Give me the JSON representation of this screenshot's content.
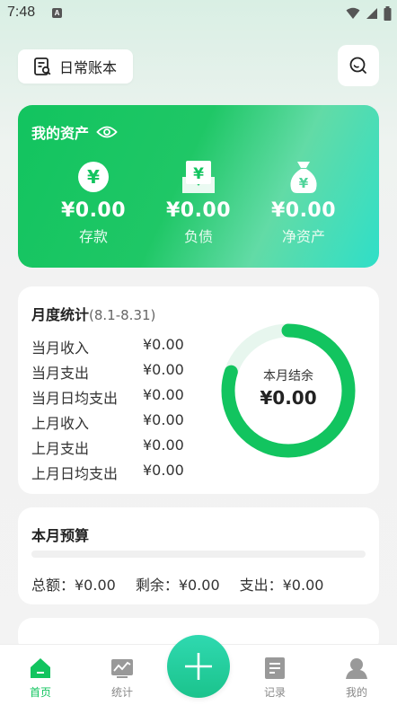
{
  "status": {
    "time": "7:48",
    "notif": "A"
  },
  "header": {
    "book_label": "日常账本"
  },
  "assets": {
    "title": "我的资产",
    "items": [
      {
        "amount": "¥0.00",
        "label": "存款",
        "icon": "yen-circle-icon"
      },
      {
        "amount": "¥0.00",
        "label": "负债",
        "icon": "yen-document-icon"
      },
      {
        "amount": "¥0.00",
        "label": "净资产",
        "icon": "money-bag-icon"
      }
    ]
  },
  "monthly": {
    "title": "月度统计",
    "range": "(8.1-8.31)",
    "rows": [
      {
        "label": "当月收入",
        "value": "¥0.00"
      },
      {
        "label": "当月支出",
        "value": "¥0.00"
      },
      {
        "label": "当月日均支出",
        "value": "¥0.00"
      },
      {
        "label": "上月收入",
        "value": "¥0.00"
      },
      {
        "label": "上月支出",
        "value": "¥0.00"
      },
      {
        "label": "上月日均支出",
        "value": "¥0.00"
      }
    ],
    "ring_label": "本月结余",
    "ring_value": "¥0.00",
    "ring_fill": 0.8,
    "colors": {
      "accent": "#12c45f",
      "track": "#e7f6ee"
    }
  },
  "budget": {
    "title": "本月预算",
    "progress": 0,
    "total": "总额：¥0.00",
    "remaining": "剩余：¥0.00",
    "spent": "支出：¥0.00"
  },
  "tabbar": {
    "tabs": [
      {
        "label": "首页",
        "icon": "home-icon",
        "active": true
      },
      {
        "label": "统计",
        "icon": "chart-icon",
        "active": false
      },
      {
        "label": "记录",
        "icon": "document-icon",
        "active": false
      },
      {
        "label": "我的",
        "icon": "user-icon",
        "active": false
      }
    ],
    "add_icon": "plus-icon"
  }
}
